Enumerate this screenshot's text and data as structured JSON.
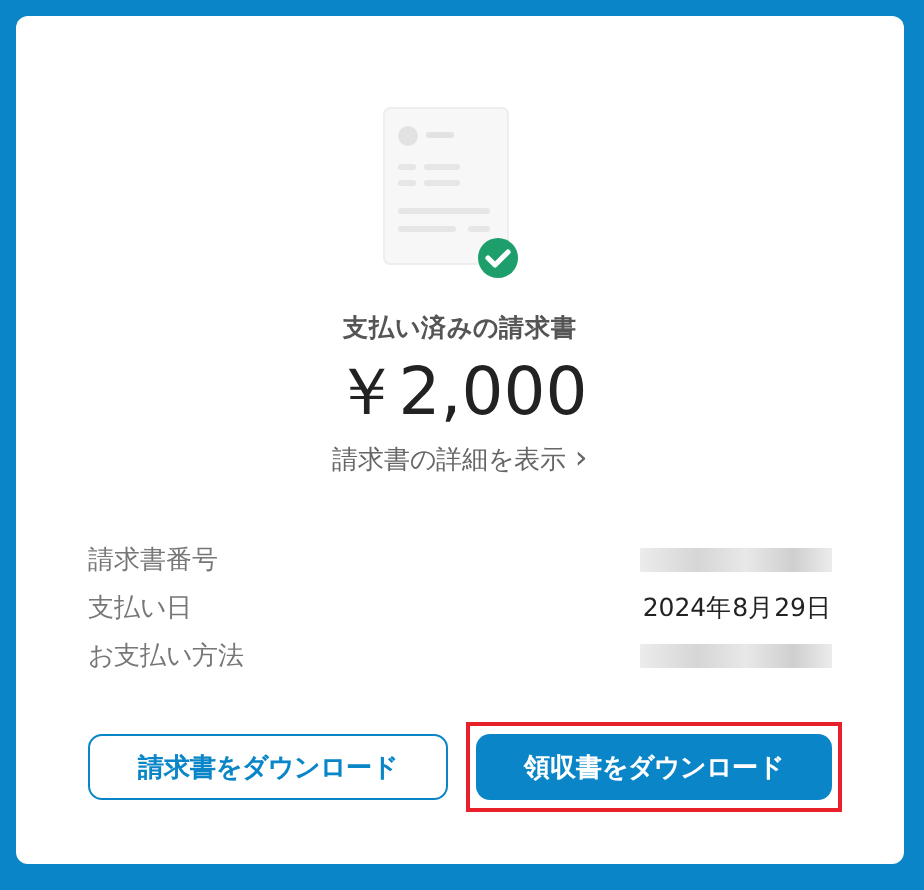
{
  "status": {
    "title": "支払い済みの請求書",
    "amount": "￥2,000",
    "details_link": "請求書の詳細を表示",
    "chevron": "›"
  },
  "details": [
    {
      "label": "請求書番号",
      "kind": "redacted"
    },
    {
      "label": "支払い日",
      "kind": "text",
      "value": "2024年8月29日"
    },
    {
      "label": "お支払い方法",
      "kind": "redacted"
    }
  ],
  "buttons": [
    {
      "label": "請求書をダウンロード",
      "kind": "outline",
      "highlighted": false
    },
    {
      "label": "領収書をダウンロード",
      "kind": "filled",
      "highlighted": true
    }
  ]
}
